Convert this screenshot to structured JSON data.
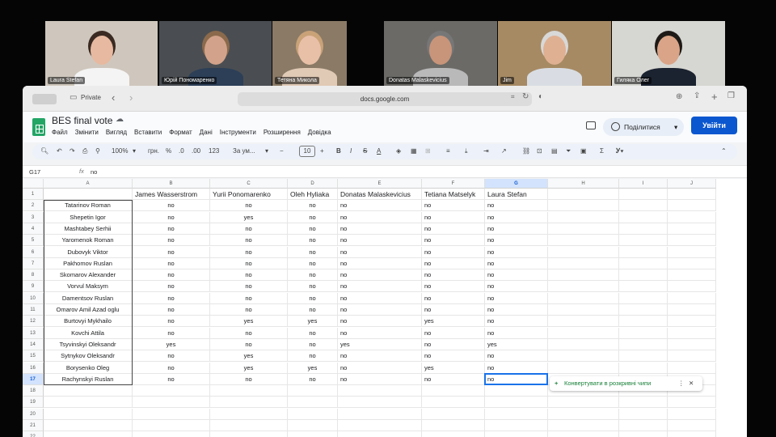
{
  "participants": [
    {
      "name": "Laura Stefan",
      "active": true
    },
    {
      "name": "Юрій Пономаренко",
      "active": false
    },
    {
      "name": "Тетяна Микола",
      "active": false
    },
    {
      "name": "Donatas Malaskevicius",
      "active": false
    },
    {
      "name": "Jim",
      "active": false
    },
    {
      "name": "Гиляка Олег",
      "active": false
    }
  ],
  "browser": {
    "private_label": "Private",
    "url": "docs.google.com"
  },
  "doc": {
    "title": "BES final vote",
    "menu": [
      "Файл",
      "Змінити",
      "Вигляд",
      "Вставити",
      "Формат",
      "Дані",
      "Інструменти",
      "Розширення",
      "Довідка"
    ],
    "share_label": "Поділитися",
    "login_label": "Увійти"
  },
  "toolbar": {
    "zoom": "100%",
    "currency": "грн.",
    "percent": "%",
    "dec_less": ".0",
    "dec_more": ".00",
    "num_format": "123",
    "font": "За ум...",
    "font_size": "10"
  },
  "formula_bar": {
    "cell_ref": "G17",
    "fx": "fx",
    "value": "no"
  },
  "sheet": {
    "columns": [
      "A",
      "B",
      "C",
      "D",
      "E",
      "F",
      "G",
      "H",
      "I",
      "J"
    ],
    "row_numbers": [
      "1",
      "2",
      "3",
      "4",
      "5",
      "6",
      "7",
      "8",
      "9",
      "10",
      "11",
      "12",
      "13",
      "14",
      "15",
      "16",
      "17",
      "18",
      "19",
      "20",
      "21",
      "22"
    ],
    "headers": [
      "",
      "James Wasserstrom",
      "Yurii Ponomarenko",
      "Oleh Hyliaka",
      "Donatas Malaskevicius",
      "Tetiana Matselyk",
      "Laura Stefan"
    ],
    "rows": [
      [
        "Tatarinov Roman",
        "no",
        "no",
        "no",
        "no",
        "no",
        "no"
      ],
      [
        "Shepetin Igor",
        "no",
        "yes",
        "no",
        "no",
        "no",
        "no"
      ],
      [
        "Mashtabey Serhii",
        "no",
        "no",
        "no",
        "no",
        "no",
        "no"
      ],
      [
        "Yaromenok Roman",
        "no",
        "no",
        "no",
        "no",
        "no",
        "no"
      ],
      [
        "Dubovyk Viktor",
        "no",
        "no",
        "no",
        "no",
        "no",
        "no"
      ],
      [
        "Pakhomov Ruslan",
        "no",
        "no",
        "no",
        "no",
        "no",
        "no"
      ],
      [
        "Skomarov Alexander",
        "no",
        "no",
        "no",
        "no",
        "no",
        "no"
      ],
      [
        "Vorvul Maksym",
        "no",
        "no",
        "no",
        "no",
        "no",
        "no"
      ],
      [
        "Damentsov Ruslan",
        "no",
        "no",
        "no",
        "no",
        "no",
        "no"
      ],
      [
        "Omarov Amil Azad oglu",
        "no",
        "no",
        "no",
        "no",
        "no",
        "no"
      ],
      [
        "Burtovyi Mykhailo",
        "no",
        "yes",
        "yes",
        "no",
        "yes",
        "no"
      ],
      [
        "Kovchi Attila",
        "no",
        "no",
        "no",
        "no",
        "no",
        "no"
      ],
      [
        "Tsyvinskyi Oleksandr",
        "yes",
        "no",
        "no",
        "yes",
        "no",
        "yes"
      ],
      [
        "Sytnykov Oleksandr",
        "no",
        "yes",
        "no",
        "no",
        "no",
        "no"
      ],
      [
        "Borysenko Oleg",
        "no",
        "yes",
        "yes",
        "no",
        "yes",
        "no"
      ],
      [
        "Rachynskyi Ruslan",
        "no",
        "no",
        "no",
        "no",
        "no",
        "no"
      ]
    ],
    "selected_cell": "G17"
  },
  "chip": {
    "label": "Конвертувати в розкривні чипи"
  }
}
